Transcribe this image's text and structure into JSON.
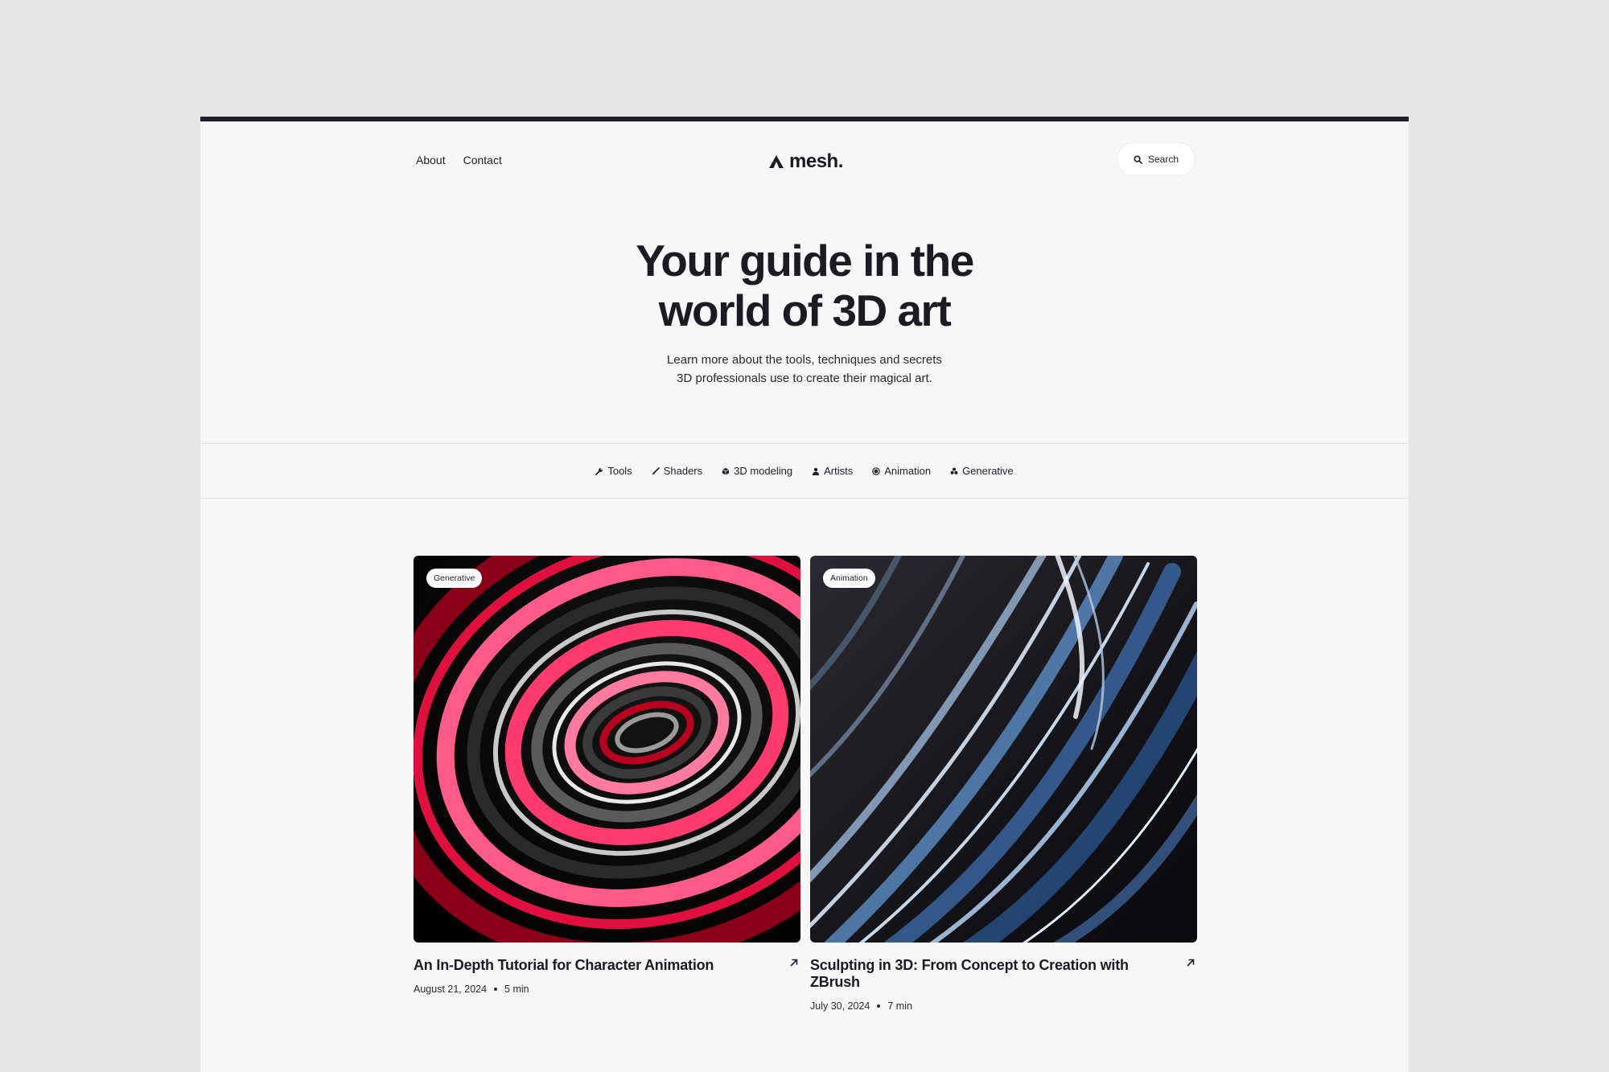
{
  "header": {
    "nav": [
      {
        "label": "About"
      },
      {
        "label": "Contact"
      }
    ],
    "logo_text": "mesh.",
    "search_label": "Search"
  },
  "hero": {
    "title_line1": "Your guide in the",
    "title_line2": "world of 3D art",
    "subtitle_line1": "Learn more about the tools, techniques and secrets",
    "subtitle_line2": "3D professionals use to create their magical art."
  },
  "categories": [
    {
      "label": "Tools",
      "icon": "wrench-icon"
    },
    {
      "label": "Shaders",
      "icon": "brush-icon"
    },
    {
      "label": "3D modeling",
      "icon": "cube-icon"
    },
    {
      "label": "Artists",
      "icon": "person-icon"
    },
    {
      "label": "Animation",
      "icon": "circle-icon"
    },
    {
      "label": "Generative",
      "icon": "sparkle-icon"
    }
  ],
  "cards": [
    {
      "badge": "Generative",
      "title": "An In-Depth Tutorial for Character Animation",
      "date": "August 21, 2024",
      "read_time": "5 min"
    },
    {
      "badge": "Animation",
      "title": "Sculpting in 3D: From Concept to Creation with ZBrush",
      "date": "July 30, 2024",
      "read_time": "7 min"
    }
  ],
  "colors": {
    "background": "#e7e7e7",
    "page": "#f7f7f7",
    "text": "#1b1b22",
    "accent_red": "#ff3a6e",
    "accent_blue": "#6aa7e0"
  }
}
